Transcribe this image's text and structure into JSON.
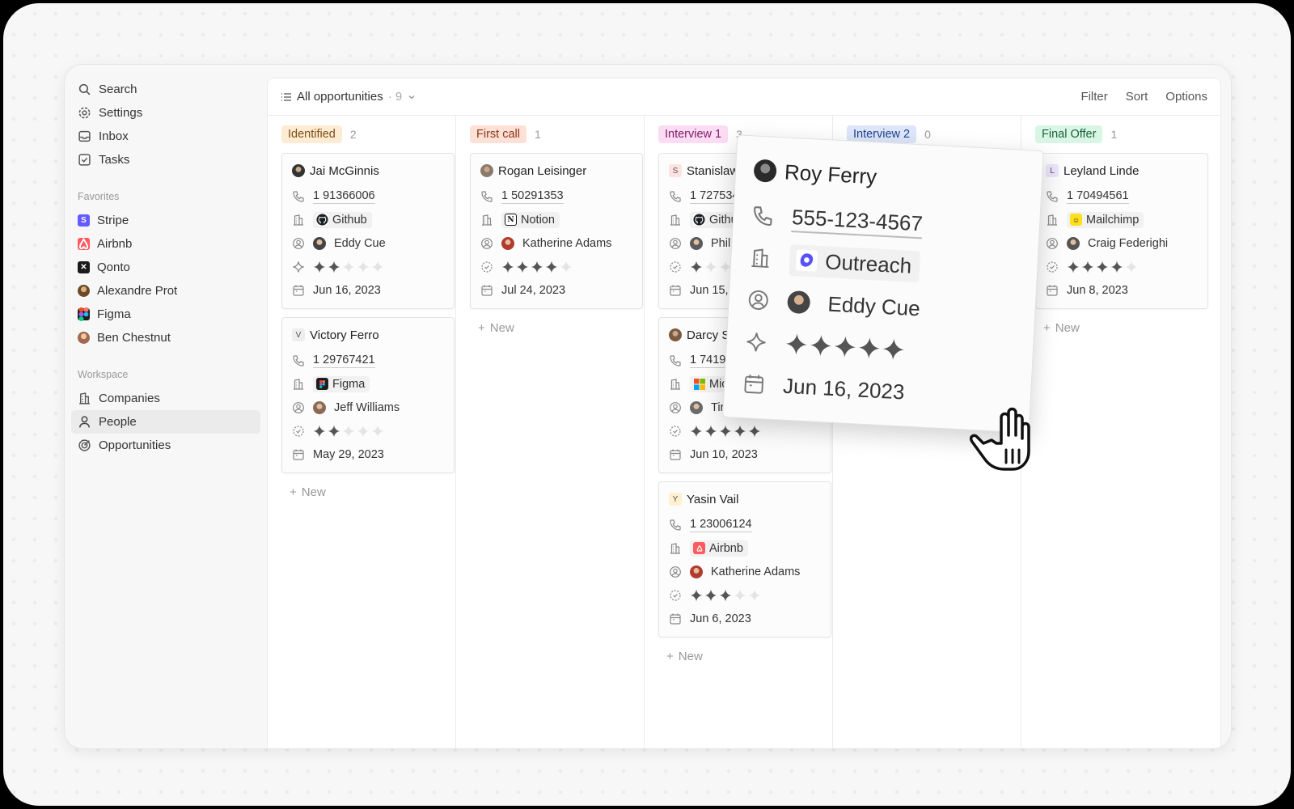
{
  "sidebar": {
    "nav": [
      {
        "label": "Search",
        "icon": "search-icon"
      },
      {
        "label": "Settings",
        "icon": "gear-icon"
      },
      {
        "label": "Inbox",
        "icon": "inbox-icon"
      },
      {
        "label": "Tasks",
        "icon": "checkbox-icon"
      }
    ],
    "favorites_label": "Favorites",
    "favorites": [
      {
        "label": "Stripe",
        "logo": "S",
        "color": "#635bff"
      },
      {
        "label": "Airbnb",
        "logo": "A",
        "color": "#ff5a5f"
      },
      {
        "label": "Qonto",
        "logo": "✕",
        "color": "#1a1a1a"
      },
      {
        "label": "Alexandre Prot",
        "color": "#a07040"
      },
      {
        "label": "Figma",
        "logo": "F",
        "color": "#1e1e1e"
      },
      {
        "label": "Ben Chestnut",
        "color": "#c09070"
      }
    ],
    "workspace_label": "Workspace",
    "workspace": [
      {
        "label": "Companies",
        "icon": "building-icon"
      },
      {
        "label": "People",
        "icon": "person-icon",
        "active": true
      },
      {
        "label": "Opportunities",
        "icon": "target-icon"
      }
    ]
  },
  "topbar": {
    "view_name": "All opportunities",
    "view_count": "· 9",
    "filter": "Filter",
    "sort": "Sort",
    "options": "Options"
  },
  "columns": [
    {
      "label": "Identified",
      "count": "2",
      "bg": "#fdecd3",
      "fg": "#7a4d12"
    },
    {
      "label": "First call",
      "count": "1",
      "bg": "#fde0d6",
      "fg": "#8a3516"
    },
    {
      "label": "Interview 1",
      "count": "3",
      "bg": "#fbdcf3",
      "fg": "#7c1d6a"
    },
    {
      "label": "Interview 2",
      "count": "0",
      "bg": "#dde6fa",
      "fg": "#21438f"
    },
    {
      "label": "Final Offer",
      "count": "1",
      "bg": "#d9f5e4",
      "fg": "#17623a"
    }
  ],
  "new_label": "New",
  "cards": {
    "identified": [
      {
        "name": "Jai McGinnis",
        "avatar_color": "#333",
        "phone": "1 91366006",
        "company": "Github",
        "company_logo": "github",
        "owner": "Eddy Cue",
        "rating": 2,
        "date": "Jun 16, 2023"
      },
      {
        "name": "Victory Ferro",
        "avatar_letter": "V",
        "phone": "1 29767421",
        "company": "Figma",
        "company_logo": "figma",
        "owner": "Jeff Williams",
        "rating": 2,
        "date": "May 29, 2023"
      }
    ],
    "first_call": [
      {
        "name": "Rogan Leisinger",
        "avatar_color": "#8b7a6a",
        "phone": "1 50291353",
        "company": "Notion",
        "company_logo": "notion",
        "owner": "Katherine Adams",
        "rating": 4,
        "date": "Jul 24, 2023"
      }
    ],
    "interview1": [
      {
        "name": "Stanislaw",
        "avatar_letter": "S",
        "phone": "1 727534",
        "company": "Githu",
        "company_logo": "github",
        "owner": "Phil S",
        "rating": 1,
        "date": "Jun 15,"
      },
      {
        "name": "Darcy S",
        "avatar_color": "#7a5a40",
        "phone": "1 74191",
        "company": "Mic",
        "company_logo": "microsoft",
        "owner": "Tir",
        "rating": 5,
        "date": "Jun 10, 2023"
      },
      {
        "name": "Yasin Vail",
        "avatar_letter": "Y",
        "phone": "1 23006124",
        "company": "Airbnb",
        "company_logo": "airbnb",
        "owner": "Katherine Adams",
        "rating": 3,
        "date": "Jun 6, 2023"
      }
    ],
    "final_offer": [
      {
        "name": "Leyland Linde",
        "avatar_letter": "L",
        "phone": "1 70494561",
        "company": "Mailchimp",
        "company_logo": "mailchimp",
        "owner": "Craig Federighi",
        "rating": 4,
        "date": "Jun 8, 2023"
      }
    ]
  },
  "drag_card": {
    "name": "Roy Ferry",
    "phone": "555-123-4567",
    "company": "Outreach",
    "owner": "Eddy Cue",
    "rating": 5,
    "date": "Jun 16, 2023"
  }
}
